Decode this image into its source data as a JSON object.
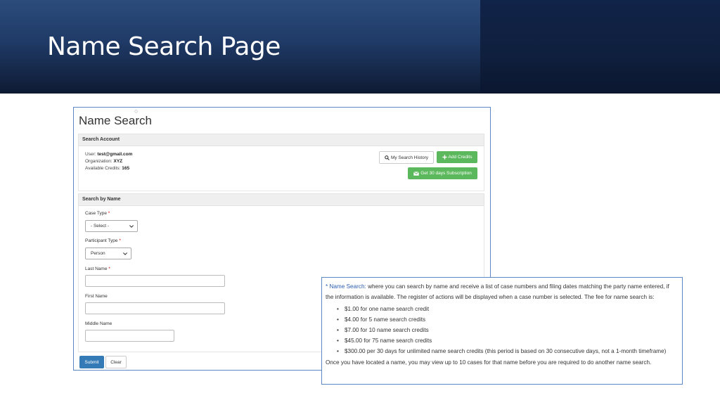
{
  "slide": {
    "title": "Name Search Page"
  },
  "screenshot": {
    "page_title": "Name Search",
    "search_account": {
      "heading": "Search Account",
      "user_label": "User:",
      "user_value": "test@gmail.com",
      "org_label": "Organization:",
      "org_value": "XYZ",
      "credits_label": "Available Credits:",
      "credits_value": "165",
      "history_button": "My Search History",
      "add_credits_button": "Add Credits",
      "subscription_button": "Get 30 days Subscription"
    },
    "search_by_name": {
      "heading": "Search by Name",
      "case_type_label": "Case Type",
      "case_type_value": "- Select -",
      "participant_type_label": "Participant Type",
      "participant_type_value": "Person",
      "last_name_label": "Last Name",
      "first_name_label": "First Name",
      "middle_name_label": "Middle Name",
      "required_mark": "*"
    },
    "submit_button": "Submit",
    "clear_button": "Clear"
  },
  "info_box": {
    "prefix": "*",
    "term": "Name Search:",
    "description": "where you can search by name and receive a list of case numbers and filing dates matching the party name entered, if the information is available. The register of actions will be displayed when a case number is selected. The fee for name search is:",
    "fees": [
      "$1.00 for one name search credit",
      "$4.00 for 5 name search credits",
      "$7.00 for 10 name search credits",
      "$45.00 for 75 name search credits",
      "$300.00 per 30 days for unlimited name search credits (this period is based on 30 consecutive days, not a 1-month timeframe)"
    ],
    "footer": "Once you have located a name, you may view up to 10 cases for that name before you are required to do another name search."
  },
  "icons": {
    "search": "search-icon",
    "plus": "plus-icon",
    "envelope": "envelope-icon",
    "chevron": "chevron-down-icon"
  },
  "colors": {
    "header_band": "#1f3a66",
    "green_button": "#5cb85c",
    "submit_blue": "#337ab7",
    "panel_border": "#5b87c5",
    "highlight": "#2a5db0"
  }
}
